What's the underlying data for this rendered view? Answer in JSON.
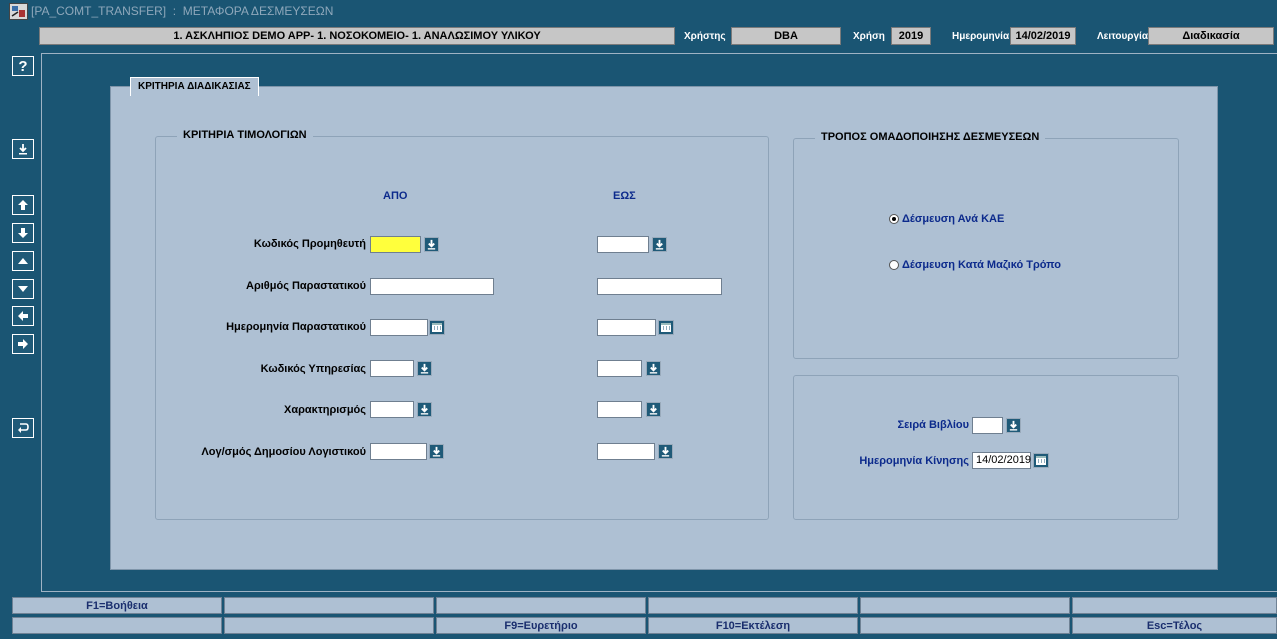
{
  "window": {
    "title": "[PA_COMT_TRANSFER]  :  ΜΕΤΑΦΟΡΑ ΔΕΣΜΕΥΣΕΩΝ"
  },
  "infobar": {
    "org": "1. ΑΣΚΛΗΠΙΟΣ DEMO APP- 1. ΝΟΣΟΚΟΜΕΙΟ- 1. ΑΝΑΛΩΣΙΜΟΥ ΥΛΙΚΟΥ",
    "user_label": "Χρήστης",
    "user_value": "DBA",
    "year_label": "Χρήση",
    "year_value": "2019",
    "date_label": "Ημερομηνία",
    "date_value": "14/02/2019",
    "function_label": "Λειτουργία",
    "function_value": "Διαδικασία"
  },
  "toolbar": {
    "help_glyph": "?"
  },
  "tab": {
    "label": "ΚΡΙΤΗΡΙΑ ΔΙΑΔΙΚΑΣΙΑΣ"
  },
  "invoice_criteria": {
    "title": "ΚΡΙΤΗΡΙΑ ΤΙΜΟΛΟΓΙΩΝ",
    "from_header": "ΑΠΟ",
    "to_header": "ΕΩΣ",
    "fields": [
      {
        "label": "Κωδικός Προμηθευτή",
        "from_value": "",
        "to_value": ""
      },
      {
        "label": "Αριθμός Παραστατικού",
        "from_value": "",
        "to_value": ""
      },
      {
        "label": "Ημερομηνία Παραστατικού",
        "from_value": "",
        "to_value": ""
      },
      {
        "label": "Κωδικός Υπηρεσίας",
        "from_value": "",
        "to_value": ""
      },
      {
        "label": "Χαρακτηρισμός",
        "from_value": "",
        "to_value": ""
      },
      {
        "label": "Λογ/σμός Δημοσίου Λογιστικού",
        "from_value": "",
        "to_value": ""
      }
    ]
  },
  "grouping": {
    "title": "ΤΡΟΠΟΣ ΟΜΑΔΟΠΟΙΗΣΗΣ ΔΕΣΜΕΥΣΕΩΝ",
    "options": [
      {
        "label": "Δέσμευση Ανά ΚΑΕ",
        "selected": true
      },
      {
        "label": "Δέσμευση Κατά Μαζικό Τρόπο",
        "selected": false
      }
    ]
  },
  "movement": {
    "book_series_label": "Σειρά Βιβλίου",
    "book_series_value": "",
    "move_date_label": "Ημερομηνία Κίνησης",
    "move_date_value": "14/02/2019"
  },
  "fkeys": {
    "row1": [
      "F1=Βοήθεια",
      "",
      "",
      "",
      "",
      ""
    ],
    "row2": [
      "",
      "",
      "F9=Ευρετήριο",
      "F10=Εκτέλεση",
      "",
      "Esc=Τέλος"
    ]
  },
  "colors": {
    "background": "#1a5573",
    "panel": "#aec0d3",
    "required_field": "#ffff3c",
    "label_blue": "#0c2a8c"
  }
}
